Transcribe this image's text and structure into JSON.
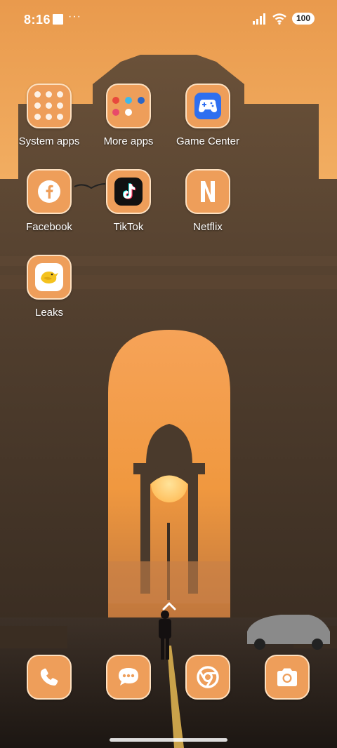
{
  "status_bar": {
    "time": "8:16",
    "notification_more": "···",
    "battery_level": "100"
  },
  "apps": [
    {
      "label": "System apps",
      "icon": "folder-icon"
    },
    {
      "label": "More apps",
      "icon": "folder-icon"
    },
    {
      "label": "Game Center",
      "icon": "gamepad-icon"
    },
    {
      "label": "Facebook",
      "icon": "facebook-icon"
    },
    {
      "label": "TikTok",
      "icon": "tiktok-icon"
    },
    {
      "label": "Netflix",
      "icon": "netflix-icon"
    },
    {
      "label": "Leaks",
      "icon": "bird-icon"
    }
  ],
  "dock": [
    {
      "name": "phone",
      "icon": "phone-icon"
    },
    {
      "name": "messages",
      "icon": "message-icon"
    },
    {
      "name": "chrome",
      "icon": "chrome-icon"
    },
    {
      "name": "camera",
      "icon": "camera-icon"
    }
  ],
  "colors": {
    "icon_tile": "#ee9e5a",
    "sky": "#f0a85a",
    "monument": "#4a3a2c"
  }
}
